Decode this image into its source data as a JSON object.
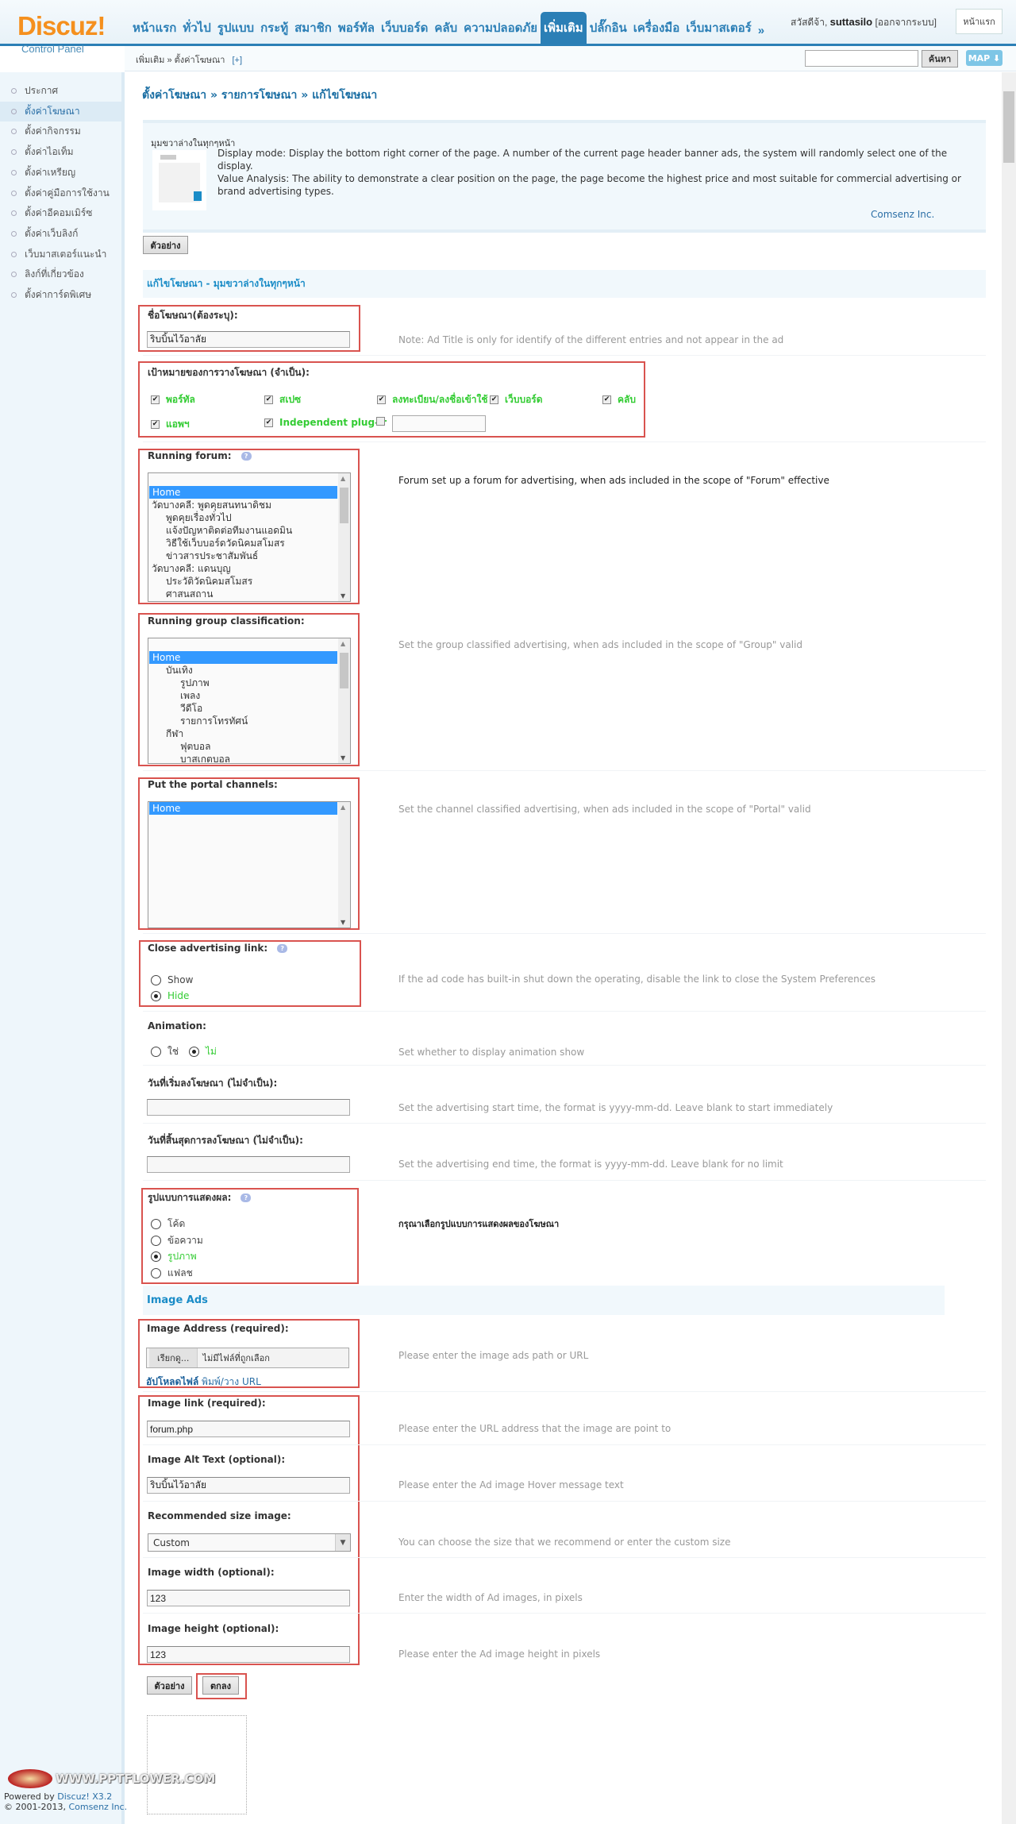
{
  "header": {
    "logo": "Discuz!",
    "logo_subtitle": "Control Panel",
    "nav_tabs": [
      "หน้าแรก",
      "ทั่วไป",
      "รูปแบบ",
      "กระทู้",
      "สมาชิก",
      "พอร์ทัล",
      "เว็บบอร์ด",
      "คลับ",
      "ความปลอดภัย",
      "เพิ่มเติม",
      "ปลั๊กอิน",
      "เครื่องมือ",
      "เว็บมาสเตอร์",
      "»"
    ],
    "active_tab": "เพิ่มเติม",
    "greeting": "สวัสดีจ้า,",
    "username": "suttasilo",
    "logout": "[ออกจากระบบ]",
    "home_button": "หน้าแรก",
    "breadcrumb": "เพิ่มเติม » ตั้งค่าโฆษณา",
    "breadcrumb_add": "[+]",
    "search_value": "",
    "search_button": "ค้นหา",
    "map_button": "MAP ⬇"
  },
  "sidebar": {
    "items": [
      "ประกาศ",
      "ตั้งค่าโฆษณา",
      "ตั้งค่ากิจกรรม",
      "ตั้งค่าไอเท็ม",
      "ตั้งค่าเหรียญ",
      "ตั้งค่าคู่มือการใช้งาน",
      "ตั้งค่าอีคอมเมิร์ซ",
      "ตั้งค่าเว็บลิงก์",
      "เว็บมาสเตอร์แนะนำ",
      "ลิงก์ที่เกี่ยวข้อง",
      "ตั้งค่าการ์ดพิเศษ"
    ],
    "active": "ตั้งค่าโฆษณา"
  },
  "main": {
    "title": "ตั้งค่าโฆษณา » รายการโฆษณา » แก้ไขโฆษณา",
    "info": {
      "title": "มุมขวาล่างในทุกๆหน้า",
      "line1": "Display mode: Display the bottom right corner of the page. A number of the current page header banner ads, the system will randomly select one of the display.",
      "line2": "Value Analysis: The ability to demonstrate a clear position on the page, the page become the highest price and most suitable for commercial advertising or brand advertising types.",
      "credit": "Comsenz Inc."
    },
    "preview_button": "ตัวอย่าง",
    "section_title": "แก้ไขโฆษณา - มุมขวาล่างในทุกๆหน้า",
    "ad_title": {
      "label": "ชื่อโฆษณา(ต้องระบุ):",
      "value": "ริบบิ้นไว้อาลัย",
      "desc": "Note: Ad Title is only for identify of the different entries and not appear in the ad"
    },
    "targets": {
      "label": "เป้าหมายของการวางโฆษณา (จำเป็น):",
      "options": [
        {
          "label": "พอร์ทัล",
          "checked": true
        },
        {
          "label": "สเปซ",
          "checked": true
        },
        {
          "label": "ลงทะเบียน/ลงชื่อเข้าใช้",
          "checked": true
        },
        {
          "label": "เว็บบอร์ด",
          "checked": true
        },
        {
          "label": "คลับ",
          "checked": true
        },
        {
          "label": "แอพฯ",
          "checked": true
        },
        {
          "label": "Independent plug-ir",
          "checked": true
        },
        {
          "label": "",
          "checked": false
        }
      ],
      "custom_value": ""
    },
    "running_forum": {
      "label": "Running forum:",
      "options": [
        "",
        "Home",
        "วัดบางคลี: พูดคุยสนทนาดิชม",
        "พูดคุยเรื่องทั่วไป",
        "แจ้งปัญหาติดต่อทีมงานแอดมิน",
        "วิธีใช้เว็บบอร์ดวัดนิคมสโมสร",
        "ข่าวสารประชาสัมพันธ์",
        "วัดบางคลี: แดนบุญ",
        "ประวัติวัดนิคมสโมสร",
        "ศาสนสถาน"
      ],
      "indent": [
        0,
        0,
        0,
        1,
        1,
        1,
        1,
        0,
        1,
        1
      ],
      "selected": "Home",
      "desc": "Forum set up a forum for advertising, when ads included in the scope of \"Forum\" effective"
    },
    "running_group": {
      "label": "Running group classification:",
      "options": [
        "",
        "Home",
        "บันเทิง",
        "รูปภาพ",
        "เพลง",
        "วีดีโอ",
        "รายการโทรทัศน์",
        "กีฬา",
        "ฟุตบอล",
        "บาสเกตบอล"
      ],
      "indent": [
        0,
        0,
        1,
        2,
        2,
        2,
        2,
        1,
        2,
        2
      ],
      "selected": "Home",
      "desc": "Set the group classified advertising, when ads included in the scope of \"Group\" valid"
    },
    "portal_channels": {
      "label": "Put the portal channels:",
      "options": [
        "Home"
      ],
      "selected": "Home",
      "desc": "Set the channel classified advertising, when ads included in the scope of \"Portal\" valid"
    },
    "close_link": {
      "label": "Close advertising link:",
      "options": [
        "Show",
        "Hide"
      ],
      "selected": "Hide",
      "desc": "If the ad code has built-in shut down the operating, disable the link to close the System Preferences"
    },
    "animation": {
      "label": "Animation:",
      "options": [
        "ใช่",
        "ไม่"
      ],
      "selected": "ไม่",
      "desc": "Set whether to display animation show"
    },
    "start_date": {
      "label": "วันที่เริ่มลงโฆษณา (ไม่จำเป็น):",
      "value": "",
      "desc": "Set the advertising start time, the format is yyyy-mm-dd. Leave blank to start immediately"
    },
    "end_date": {
      "label": "วันที่สิ้นสุดการลงโฆษณา (ไม่จำเป็น):",
      "value": "",
      "desc": "Set the advertising end time, the format is yyyy-mm-dd. Leave blank for no limit"
    },
    "display_format": {
      "label": "รูปแบบการแสดงผล:",
      "options": [
        "โค้ด",
        "ข้อความ",
        "รูปภาพ",
        "แฟลช"
      ],
      "selected": "รูปภาพ",
      "desc": "กรุณาเลือกรูปแบบการแสดงผลของโฆษณา"
    },
    "image_section_title": "Image Ads",
    "image_address": {
      "label": "Image Address (required):",
      "browse_button": "เรียกดู...",
      "no_file": "ไม่มีไฟล์ที่ถูกเลือก",
      "upload_link": "อัปโหลดไฟล์",
      "url_link": "พิมพ์/วาง URL",
      "desc": "Please enter the image ads path or URL"
    },
    "image_link": {
      "label": "Image link (required):",
      "value": "forum.php",
      "desc": "Please enter the URL address that the image are point to"
    },
    "image_alt": {
      "label": "Image Alt Text (optional):",
      "value": "ริบบิ้นไว้อาลัย",
      "desc": "Please enter the Ad image Hover message text"
    },
    "image_size": {
      "label": "Recommended size image:",
      "value": "Custom",
      "desc": "You can choose the size that we recommend or enter the custom size"
    },
    "image_width": {
      "label": "Image width (optional):",
      "value": "123",
      "desc": "Enter the width of Ad images, in pixels"
    },
    "image_height": {
      "label": "Image height (optional):",
      "value": "123",
      "desc": "Please enter the Ad image height in pixels"
    },
    "submit_button": "ตกลง"
  },
  "footer": {
    "powered": "Powered by",
    "product": "Discuz! X3.2",
    "copyright": "© 2001-2013,",
    "company": "Comsenz Inc.",
    "watermark": "WWW.PPTFLOWER.COM"
  },
  "colors": {
    "accent": "#2b7fb6",
    "logo": "#f5901e",
    "highlight_box": "#d9534f",
    "checked_label": "#33cc33",
    "selection": "#3399ff"
  }
}
